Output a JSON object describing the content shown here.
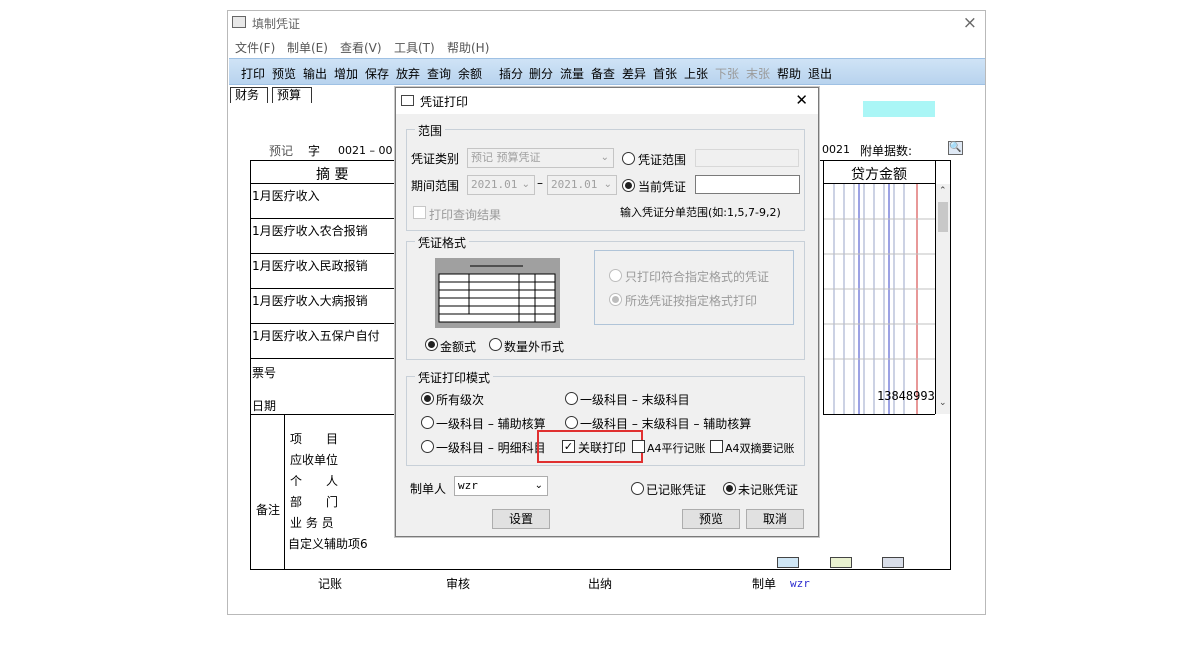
{
  "window": {
    "title": "填制凭证",
    "close": "×"
  },
  "menu": [
    "文件(F)",
    "制单(E)",
    "查看(V)",
    "工具(T)",
    "帮助(H)"
  ],
  "toolbar": [
    {
      "label": "打印",
      "enabled": true
    },
    {
      "label": "预览",
      "enabled": true
    },
    {
      "label": "输出",
      "enabled": true
    },
    {
      "label": "增加",
      "enabled": true
    },
    {
      "label": "保存",
      "enabled": true
    },
    {
      "label": "放弃",
      "enabled": true
    },
    {
      "label": "查询",
      "enabled": true
    },
    {
      "label": "余额",
      "enabled": true
    },
    {
      "label": "插分",
      "enabled": true
    },
    {
      "label": "删分",
      "enabled": true
    },
    {
      "label": "流量",
      "enabled": true
    },
    {
      "label": "备查",
      "enabled": true
    },
    {
      "label": "差异",
      "enabled": true
    },
    {
      "label": "首张",
      "enabled": true
    },
    {
      "label": "上张",
      "enabled": true
    },
    {
      "label": "下张",
      "enabled": false
    },
    {
      "label": "末张",
      "enabled": false
    },
    {
      "label": "帮助",
      "enabled": true
    },
    {
      "label": "退出",
      "enabled": true
    }
  ],
  "tabs": [
    "财务",
    "预算"
  ],
  "voucher": {
    "type_label": "预记",
    "zi": "字",
    "number_prefix": "0021 – 00",
    "number_right": "0021",
    "attach_label": "附单据数:",
    "summary_header": "摘 要",
    "credit_header": "贷方金额",
    "rows": [
      "1月医疗收入",
      "1月医疗收入农合报销",
      "1月医疗收入民政报销",
      "1月医疗收入大病报销",
      "1月医疗收入五保户自付"
    ],
    "ticket_label": "票号",
    "date_label": "日期",
    "total_credit": "13848993",
    "notes_label": "备注",
    "aux_items": [
      "项　　目",
      "应收单位",
      "个　　人",
      "部　　门",
      "业 务 员",
      "自定义辅助项6"
    ],
    "footer": {
      "post": "记账",
      "review": "审核",
      "cashier": "出纳",
      "maker_label": "制单",
      "maker": "wzr"
    }
  },
  "dialog": {
    "title": "凭证打印",
    "close": "✕",
    "range": {
      "group_label": "范围",
      "voucher_type_label": "凭证类别",
      "voucher_type_value": "预记 预算凭证",
      "period_label": "期间范围",
      "period_from": "2021.01",
      "period_to": "2021.01",
      "dash": "–",
      "opt_range": "凭证范围",
      "opt_current": "当前凭证",
      "print_query": "打印查询结果",
      "hint": "输入凭证分单范围(如:1,5,7-9,2)"
    },
    "format": {
      "group_label": "凭证格式",
      "opt_matching": "只打印符合指定格式的凭证",
      "opt_selected": "所选凭证按指定格式打印",
      "opt_amount": "金额式",
      "opt_quantity": "数量外币式"
    },
    "mode": {
      "group_label": "凭证打印模式",
      "opt_all": "所有级次",
      "opt_first_last": "一级科目 – 末级科目",
      "opt_first_aux": "一级科目 – 辅助核算",
      "opt_first_last_aux": "一级科目 – 末级科目 – 辅助核算",
      "opt_first_detail": "一级科目 – 明细科目",
      "linked_print": "关联打印",
      "a4_parallel": "A4平行记账",
      "a4_double": "A4双摘要记账"
    },
    "maker_label": "制单人",
    "maker_value": "wzr",
    "opt_posted": "已记账凭证",
    "opt_unposted": "未记账凭证",
    "btn_settings": "设置",
    "btn_preview": "预览",
    "btn_cancel": "取消"
  },
  "colors": {
    "toolbar": "#c4dbf2",
    "highlight_box": "#e03030",
    "cyan_cell": "#aaf6f6"
  }
}
